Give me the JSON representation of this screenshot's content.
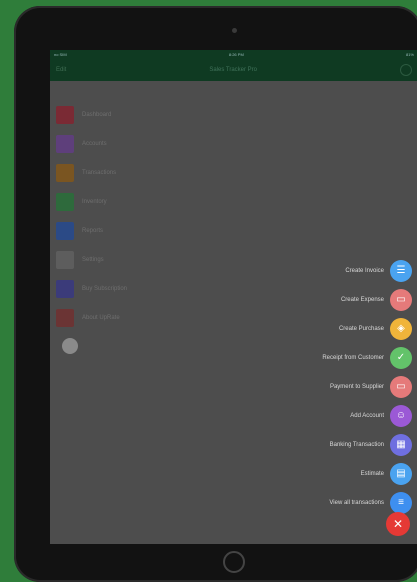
{
  "statusbar": {
    "carrier": "no SIM",
    "time": "8:26 PM",
    "battery": "81%"
  },
  "navbar": {
    "left": "Edit",
    "title": "Sales Tracker Pro"
  },
  "menu": [
    {
      "label": "Dashboard",
      "color": "#7a2a34",
      "icon": "dashboard-icon"
    },
    {
      "label": "Accounts",
      "color": "#5e3f7b",
      "icon": "accounts-icon"
    },
    {
      "label": "Transactions",
      "color": "#7a5521",
      "icon": "transactions-icon"
    },
    {
      "label": "Inventory",
      "color": "#2e6a3c",
      "icon": "inventory-icon"
    },
    {
      "label": "Reports",
      "color": "#2b4a86",
      "icon": "reports-icon"
    },
    {
      "label": "Settings",
      "color": "#5d5d5d",
      "icon": "settings-icon"
    },
    {
      "label": "Buy Subscription",
      "color": "#3b3b7a",
      "icon": "subscription-icon"
    },
    {
      "label": "About UpRate",
      "color": "#6b3434",
      "icon": "about-icon"
    }
  ],
  "actions": [
    {
      "label": "Create Invoice",
      "color": "#4aa3f0",
      "icon": "invoice-icon",
      "glyph": "☰"
    },
    {
      "label": "Create Expense",
      "color": "#e57a7a",
      "icon": "expense-icon",
      "glyph": "▭"
    },
    {
      "label": "Create Purchase",
      "color": "#f0b43a",
      "icon": "purchase-icon",
      "glyph": "◈"
    },
    {
      "label": "Receipt from Customer",
      "color": "#63c36a",
      "icon": "receipt-icon",
      "glyph": "✓"
    },
    {
      "label": "Payment to Supplier",
      "color": "#e57a7a",
      "icon": "payment-icon",
      "glyph": "▭"
    },
    {
      "label": "Add Account",
      "color": "#9b59d6",
      "icon": "user-icon",
      "glyph": "☺"
    },
    {
      "label": "Banking Transaction",
      "color": "#6f6fe0",
      "icon": "bank-icon",
      "glyph": "▦"
    },
    {
      "label": "Estimate",
      "color": "#4aa3f0",
      "icon": "estimate-icon",
      "glyph": "▤"
    },
    {
      "label": "View all transactions",
      "color": "#3e8ff0",
      "icon": "list-icon",
      "glyph": "≡"
    }
  ],
  "close": {
    "color": "#e53935",
    "glyph": "✕"
  }
}
